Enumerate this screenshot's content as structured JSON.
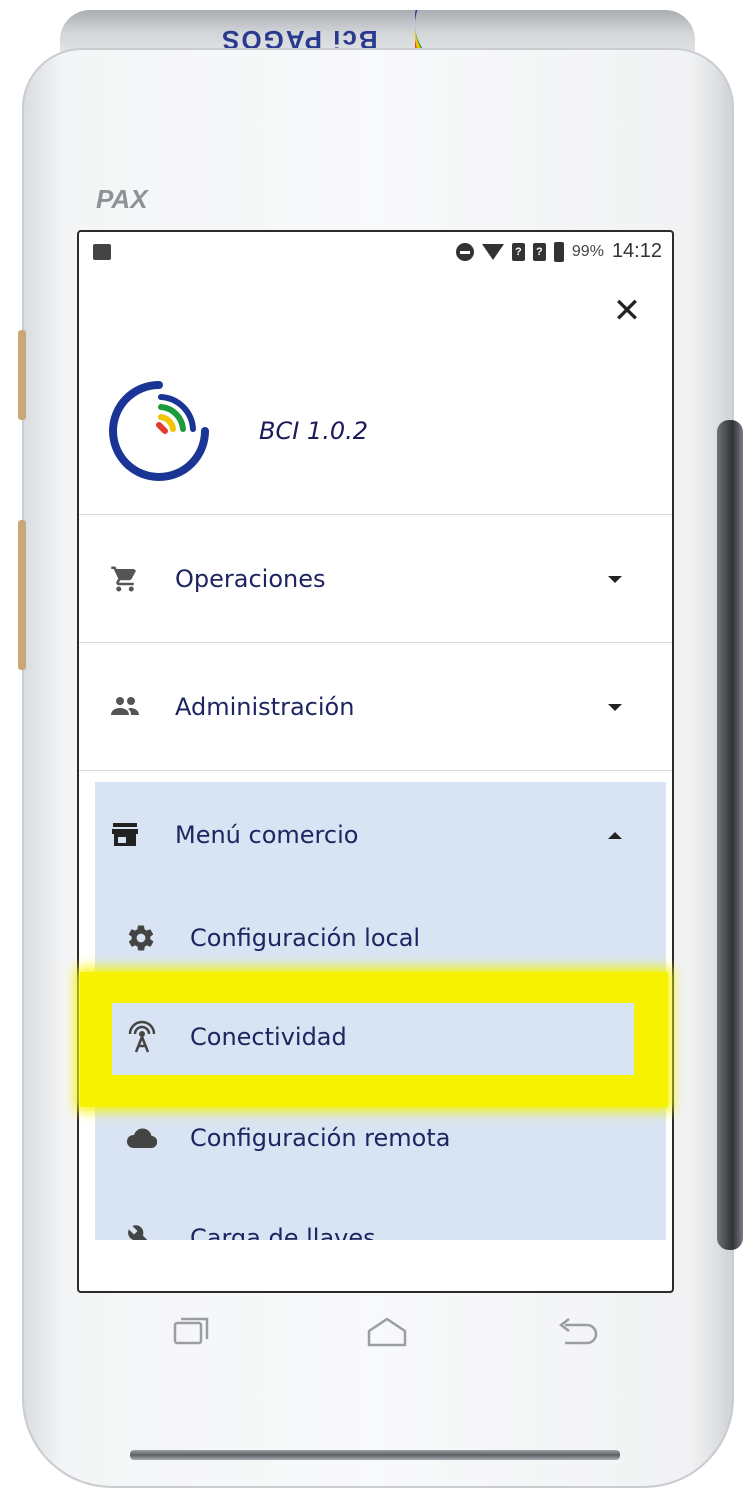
{
  "device": {
    "cap_brand": "Bci PAGOS",
    "logo_text": "PAX"
  },
  "statusbar": {
    "battery": "99%",
    "time": "14:12",
    "sim_glyph": "?"
  },
  "header": {
    "close_glyph": "✕",
    "app_version": "BCI  1.0.2"
  },
  "menu": {
    "items": [
      {
        "label": "Operaciones",
        "icon": "cart-icon",
        "expanded": false
      },
      {
        "label": "Administración",
        "icon": "people-icon",
        "expanded": false
      },
      {
        "label": "Menú comercio",
        "icon": "store-icon",
        "expanded": true
      }
    ],
    "submenu": [
      {
        "label": "Configuración local",
        "icon": "gear-icon"
      },
      {
        "label": "Conectividad",
        "icon": "antenna-icon",
        "highlighted": true
      },
      {
        "label": "Configuración remota",
        "icon": "cloud-icon"
      },
      {
        "label": "Carga de llaves",
        "icon": "wrench-icon"
      }
    ]
  },
  "colors": {
    "highlight": "#f7f300",
    "submenu_bg": "#d8e4f3",
    "text": "#1e2560"
  }
}
